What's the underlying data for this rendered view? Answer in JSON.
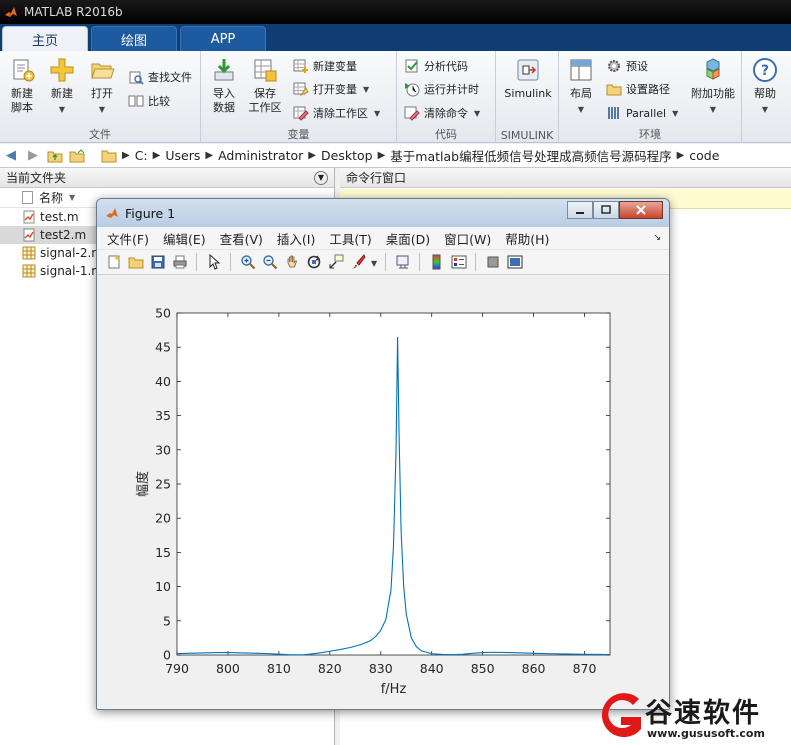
{
  "app": {
    "title": "MATLAB R2016b"
  },
  "tabs": [
    {
      "label": "主页"
    },
    {
      "label": "绘图"
    },
    {
      "label": "APP"
    }
  ],
  "ribbon": {
    "file": {
      "group_label": "文件",
      "new_script": "新建\n脚本",
      "new": "新建",
      "open": "打开",
      "find_files": "查找文件",
      "compare": "比较"
    },
    "variable": {
      "group_label": "变量",
      "import": "导入\n数据",
      "save_ws": "保存\n工作区",
      "new_var": "新建变量",
      "open_var": "打开变量",
      "clear_ws": "清除工作区"
    },
    "code": {
      "group_label": "代码",
      "analyze": "分析代码",
      "run_time": "运行并计时",
      "clear_cmd": "清除命令"
    },
    "simulink": {
      "group_label": "SIMULINK",
      "simulink": "Simulink"
    },
    "env": {
      "group_label": "环境",
      "layout": "布局",
      "prefs": "预设",
      "set_path": "设置路径",
      "parallel": "Parallel",
      "addons": "附加功能"
    },
    "help": {
      "label": "帮助"
    }
  },
  "address": {
    "crumbs": [
      "C:",
      "Users",
      "Administrator",
      "Desktop",
      "基于matlab编程低频信号处理成高频信号源码程序",
      "code"
    ]
  },
  "left_panel": {
    "title": "当前文件夹",
    "col_name": "名称",
    "files": [
      {
        "name": "test.m"
      },
      {
        "name": "test2.m"
      },
      {
        "name": "signal-2.m"
      },
      {
        "name": "signal-1.m"
      }
    ]
  },
  "cmd_panel": {
    "title": "命令行窗口"
  },
  "figure": {
    "title": "Figure 1",
    "menu": [
      "文件(F)",
      "编辑(E)",
      "查看(V)",
      "插入(I)",
      "工具(T)",
      "桌面(D)",
      "窗口(W)",
      "帮助(H)"
    ]
  },
  "chart_data": {
    "type": "line",
    "xlabel": "f/Hz",
    "ylabel": "幅度",
    "xlim": [
      790,
      875
    ],
    "ylim": [
      0,
      50
    ],
    "xticks": [
      790,
      800,
      810,
      820,
      830,
      840,
      850,
      860,
      870
    ],
    "yticks": [
      0,
      5,
      10,
      15,
      20,
      25,
      30,
      35,
      40,
      45,
      50
    ],
    "grid": false,
    "line_color": "#0072bd",
    "series": [
      {
        "x": [
          790,
          792,
          795,
          798,
          800,
          803,
          806,
          808,
          810,
          812,
          814,
          815,
          816,
          818,
          820,
          822,
          824,
          826,
          828,
          829,
          830,
          831,
          832,
          832.5,
          833,
          833.3,
          833.6,
          834,
          834.5,
          835,
          836,
          837,
          838,
          840,
          842,
          844,
          846,
          848,
          850,
          852,
          855,
          858,
          860,
          863,
          866,
          870,
          873,
          875
        ],
        "y": [
          0.2,
          0.25,
          0.3,
          0.35,
          0.35,
          0.3,
          0.25,
          0.2,
          0.12,
          0.05,
          0.02,
          0.05,
          0.12,
          0.3,
          0.55,
          0.8,
          1.1,
          1.5,
          2.1,
          2.7,
          3.6,
          5.2,
          9.5,
          16,
          30,
          46.5,
          32,
          18,
          10,
          6,
          2.5,
          1.2,
          0.6,
          0.2,
          0.08,
          0.04,
          0.1,
          0.25,
          0.35,
          0.4,
          0.35,
          0.3,
          0.25,
          0.2,
          0.15,
          0.1,
          0.08,
          0.06
        ]
      }
    ]
  },
  "watermark": {
    "text": "谷速软件",
    "url": "www.gususoft.com"
  }
}
